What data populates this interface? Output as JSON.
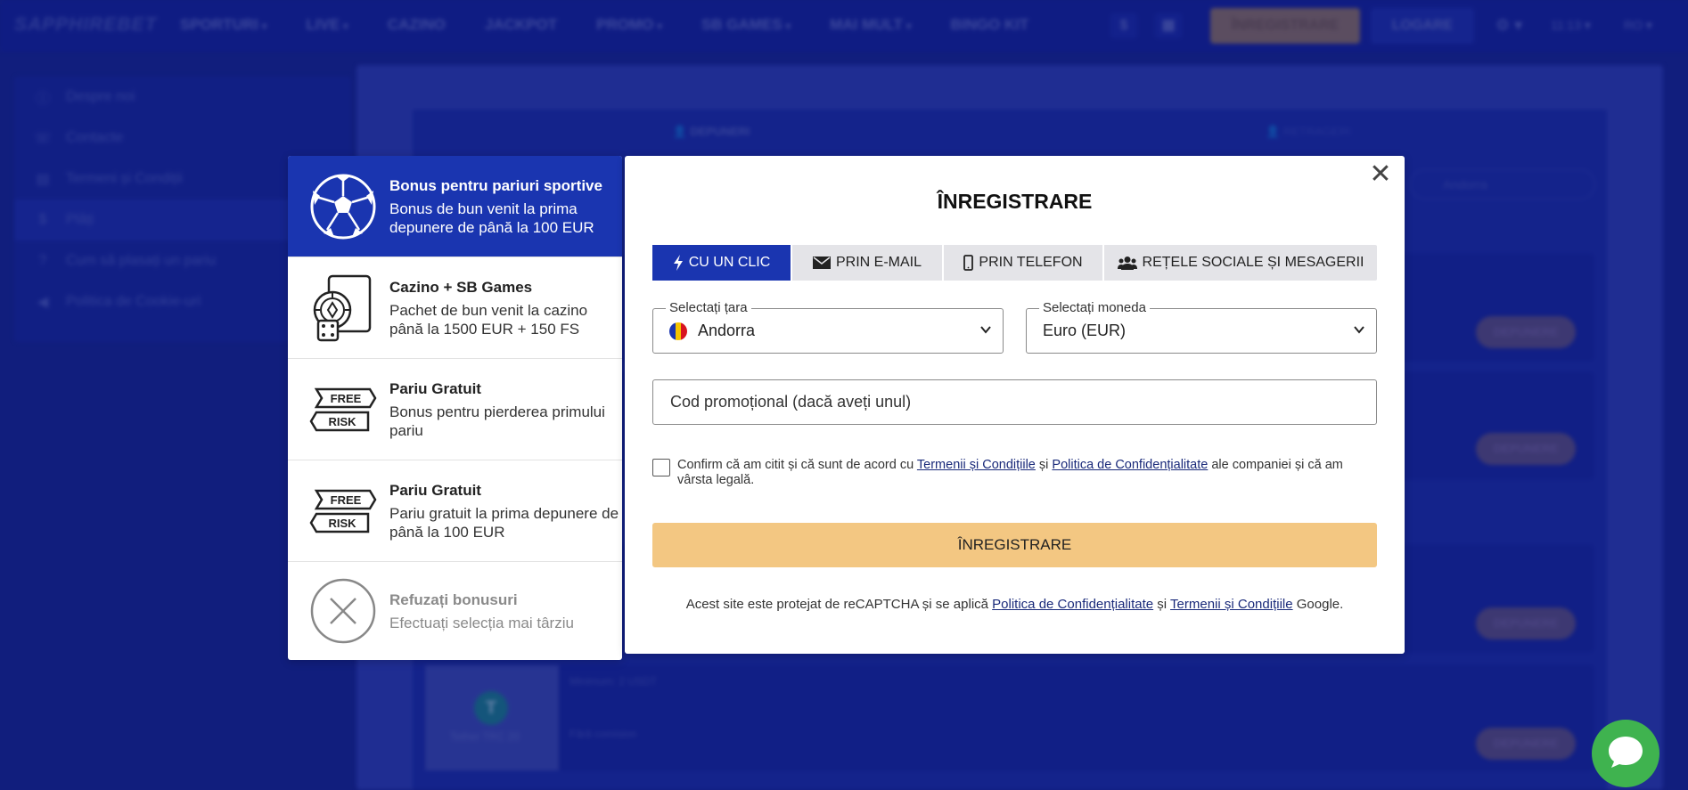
{
  "background": {
    "logo": "SAPPHIREBET",
    "nav": [
      "SPORTURI",
      "LIVE",
      "CAZINO",
      "JACKPOT",
      "PROMO",
      "SB GAMES",
      "MAI MULT",
      "BINGO KIT"
    ],
    "register_label": "ÎNREGISTRARE",
    "login_label": "LOGARE",
    "time": "11:13",
    "lang": "RO",
    "sidebar": [
      "Despre noi",
      "Contacte",
      "Termeni și Condiții",
      "Plăți",
      "Cum să plasați un pariu",
      "Politica de Cookie-uri"
    ],
    "tab_deposit": "DEPUNERI",
    "tab_withdraw": "RETRAGERI",
    "country": "Andorra",
    "deposit_btn": "DEPUNERE",
    "tether_label": "Tether TRC 20",
    "min_label": "Minimum: 2 USDT",
    "fee_label": "Fără comision"
  },
  "bonuses": [
    {
      "title": "Bonus pentru pariuri sportive",
      "desc": "Bonus de bun venit la prima depunere de până la 100 EUR",
      "icon": "soccer-ball-icon"
    },
    {
      "title": "Cazino + SB Games",
      "desc": "Pachet de bun venit la cazino până la 1500 EUR + 150 FS",
      "icon": "casino-cards-chip-dice-icon"
    },
    {
      "title": "Pariu Gratuit",
      "desc": "Bonus pentru pierderea primului pariu",
      "icon": "free-risk-icon"
    },
    {
      "title": "Pariu Gratuit",
      "desc": "Pariu gratuit la prima depunere de până la 100 EUR",
      "icon": "free-risk-icon"
    },
    {
      "title": "Refuzați bonusuri",
      "desc": "Efectuați selecția mai târziu",
      "icon": "refuse-x-icon"
    }
  ],
  "free_risk": {
    "free": "FREE",
    "risk": "RISK"
  },
  "modal": {
    "title": "ÎNREGISTRARE",
    "close": "✕",
    "tabs": [
      "CU UN CLIC",
      "PRIN E-MAIL",
      "PRIN TELEFON",
      "REȚELE SOCIALE ȘI MESAGERII"
    ],
    "country_label": "Selectați țara",
    "country_value": "Andorra",
    "currency_label": "Selectați moneda",
    "currency_value": "Euro (EUR)",
    "promo_placeholder": "Cod promoțional (dacă aveți unul)",
    "consent": {
      "pre": "Confirm că am citit și că sunt de acord cu ",
      "terms": "Termenii și Condițiile",
      "and": " și ",
      "privacy": "Politica de Confidențialitate",
      "post": " ale companiei și că am vârsta legală."
    },
    "submit": "ÎNREGISTRARE",
    "captcha": {
      "pre": "Acest site este protejat de reCAPTCHA și se aplică ",
      "privacy": "Politica de Confidențialitate",
      "and": " și ",
      "terms": "Termenii și Condițiile",
      "post": " Google."
    }
  },
  "colors": {
    "primary": "#1a35b0",
    "submit": "#f3c782",
    "chat": "#3fb34f"
  }
}
